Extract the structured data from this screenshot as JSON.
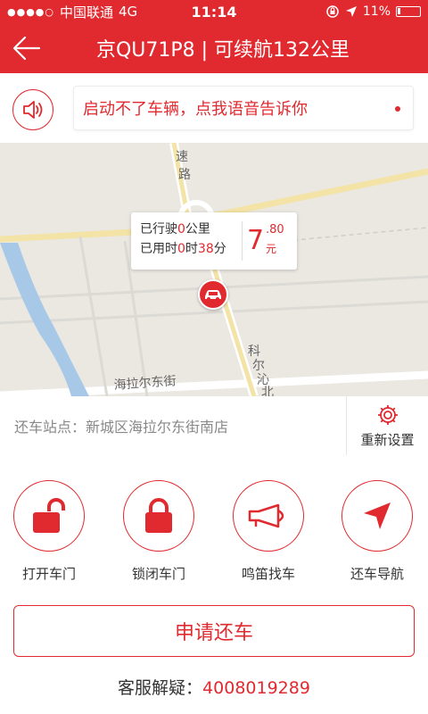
{
  "status_bar": {
    "signal_dots": "●●●●○",
    "carrier": "中国联通",
    "network": "4G",
    "time": "11:14",
    "battery": "11%"
  },
  "navbar": {
    "title": "京QU71P8 | 可续航132公里"
  },
  "voice": {
    "prompt": "启动不了车辆，点我语音告诉你"
  },
  "map": {
    "road_labels": {
      "road1": "速",
      "road2": "路",
      "road3": "海拉尔东街",
      "road4": "科",
      "road5": "尔",
      "road6": "沁",
      "road7": "北"
    },
    "info": {
      "distance_prefix": "已行驶",
      "distance_value": "0",
      "distance_unit": "公里",
      "time_prefix": "已用时",
      "hours": "0",
      "hours_unit": "时",
      "minutes": "38",
      "minutes_unit": "分",
      "price_int": "7",
      "price_dec": ".80",
      "price_unit": "元"
    }
  },
  "station": {
    "text": "还车站点：新城区海拉尔东街南店",
    "reset_label": "重新设置"
  },
  "actions": [
    {
      "label": "打开车门",
      "icon": "unlock-icon"
    },
    {
      "label": "锁闭车门",
      "icon": "lock-icon"
    },
    {
      "label": "鸣笛找车",
      "icon": "horn-icon"
    },
    {
      "label": "还车导航",
      "icon": "navigation-icon"
    }
  ],
  "apply_button": "申请还车",
  "service": {
    "label": "客服解疑：",
    "phone": "4008019289"
  },
  "colors": {
    "accent": "#e02a2f"
  }
}
